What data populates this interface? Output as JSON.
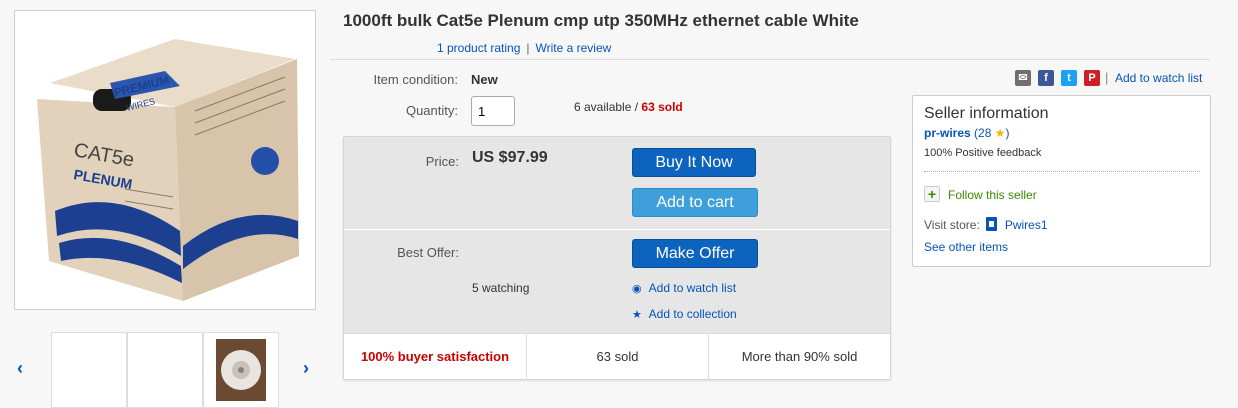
{
  "listing": {
    "title": "1000ft bulk Cat5e Plenum cmp utp 350MHz ethernet cable White",
    "rating_text": "1 product rating",
    "rating_sep": "|",
    "write_review": "Write a review"
  },
  "item": {
    "condition_label": "Item condition:",
    "condition_value": "New",
    "quantity_label": "Quantity:",
    "quantity_value": "1",
    "available_text": "6 available",
    "available_sep": " / ",
    "sold_text": "63 sold"
  },
  "buybox": {
    "price_label": "Price:",
    "price_value": "US $97.99",
    "buy_it_now": "Buy It Now",
    "add_to_cart": "Add to cart",
    "best_offer_label": "Best Offer:",
    "make_offer": "Make Offer",
    "watching": "5 watching",
    "add_to_watch": "Add to watch list",
    "add_to_collection": "Add to collection",
    "stats": [
      "100% buyer satisfaction",
      "63 sold",
      "More than 90% sold"
    ]
  },
  "share": {
    "icons": [
      "mail-icon",
      "facebook-icon",
      "twitter-icon",
      "pinterest-icon"
    ],
    "sep": "|",
    "watch_link": "Add to watch list"
  },
  "seller": {
    "heading": "Seller information",
    "name": "pr-wires",
    "score_open": " (",
    "score": "28",
    "score_close": ")",
    "feedback": "100% Positive feedback",
    "follow": "Follow this seller",
    "store_label": "Visit store:",
    "store_name": "Pwires1",
    "other_items": "See other items"
  },
  "gallery": {
    "box_brand": "PREMIUM",
    "box_brand_sub": "WIRES",
    "box_label": "CAT5e",
    "box_label_sub": "PLENUM"
  },
  "colors": {
    "link": "#0654ba",
    "buy_button": "#0c64bf",
    "cart_button": "#3e9fdb",
    "sold_red": "#cc0000",
    "follow_green": "#3c8a00"
  }
}
